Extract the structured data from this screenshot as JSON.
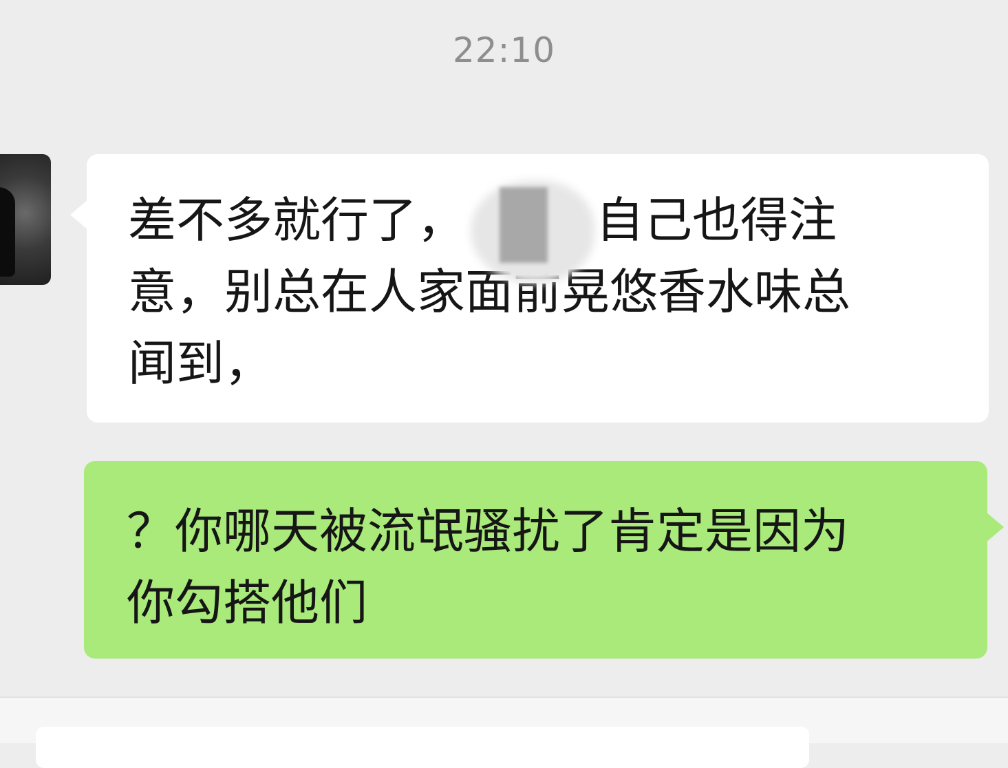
{
  "chat": {
    "timestamp": "22:10",
    "messages": [
      {
        "direction": "incoming",
        "line1_a": "差不多就行了，",
        "line1_b": "自己也得注",
        "line2": "意，别总在人家面前晃悠香水味总",
        "line3": "闻到，"
      },
      {
        "direction": "outgoing",
        "line1": "？你哪天被流氓骚扰了肯定是因为",
        "line2": "你勾搭他们"
      }
    ]
  },
  "colors": {
    "background": "#ededed",
    "incoming_bubble": "#ffffff",
    "outgoing_bubble": "#a9ea7a",
    "timestamp_text": "#8e8e8e"
  }
}
